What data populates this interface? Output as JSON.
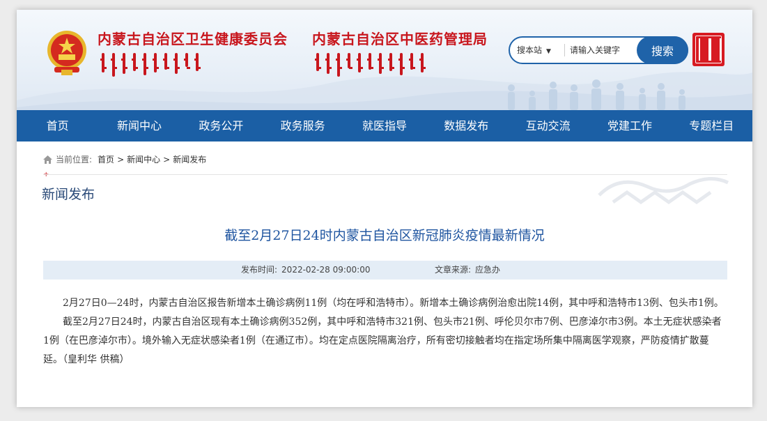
{
  "header": {
    "org_title_1": "内蒙古自治区卫生健康委员会",
    "org_title_2": "内蒙古自治区中医药管理局",
    "search": {
      "scope_label": "搜本站",
      "placeholder": "请输入关键字",
      "button_label": "搜索"
    },
    "colors": {
      "brand_red": "#c8161d",
      "brand_blue": "#1b5fa5"
    }
  },
  "nav": {
    "items": [
      {
        "label": "首页"
      },
      {
        "label": "新闻中心"
      },
      {
        "label": "政务公开"
      },
      {
        "label": "政务服务"
      },
      {
        "label": "就医指导"
      },
      {
        "label": "数据发布"
      },
      {
        "label": "互动交流"
      },
      {
        "label": "党建工作"
      },
      {
        "label": "专题栏目"
      }
    ]
  },
  "breadcrumb": {
    "prefix": "当前位置:",
    "items": [
      "首页",
      "新闻中心",
      "新闻发布"
    ],
    "separator": ">"
  },
  "section": {
    "mark": "+",
    "title": "新闻发布"
  },
  "article": {
    "title": "截至2月27日24时内蒙古自治区新冠肺炎疫情最新情况",
    "publish_label": "发布时间:",
    "publish_time": "2022-02-28 09:00:00",
    "source_label": "文章来源:",
    "source": "应急办",
    "paragraphs": [
      "2月27日0—24时，内蒙古自治区报告新增本土确诊病例11例（均在呼和浩特市）。新增本土确诊病例治愈出院14例，其中呼和浩特市13例、包头市1例。",
      "截至2月27日24时，内蒙古自治区现有本土确诊病例352例，其中呼和浩特市321例、包头市21例、呼伦贝尔市7例、巴彦淖尔市3例。本土无症状感染者1例（在巴彦淖尔市）。境外输入无症状感染者1例（在通辽市）。均在定点医院隔离治疗，所有密切接触者均在指定场所集中隔离医学观察，严防疫情扩散蔓延。（皇利华 供稿）"
    ]
  }
}
